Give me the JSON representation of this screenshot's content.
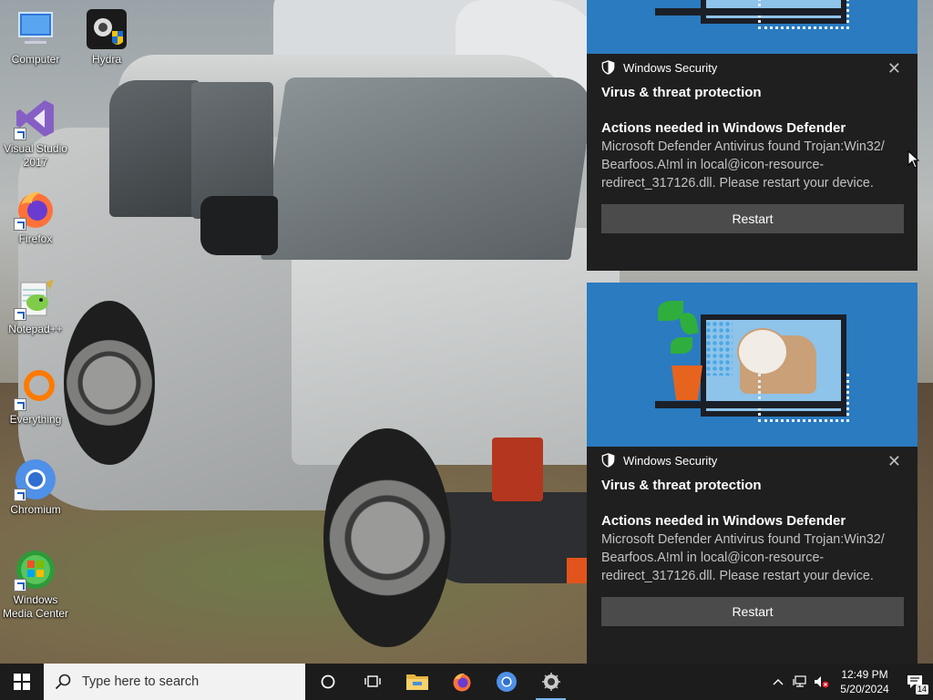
{
  "desktop": {
    "icons": [
      {
        "label": "Computer"
      },
      {
        "label": "Hydra"
      },
      {
        "label": "Visual Studio 2017"
      },
      {
        "label": "Firefox"
      },
      {
        "label": "Notepad++"
      },
      {
        "label": "Everything"
      },
      {
        "label": "Chromium"
      },
      {
        "label": "Windows Media Center"
      }
    ]
  },
  "notifications": [
    {
      "app_name": "Windows Security",
      "title": "Virus & threat protection",
      "subtitle": "Actions needed in Windows Defender",
      "body": "Microsoft Defender Antivirus found Trojan:Win32/ Bearfoos.A!ml in local@icon-resource-redirect_317126.dll. Please restart your device.",
      "button_label": "Restart",
      "close_symbol": "✕"
    },
    {
      "app_name": "Windows Security",
      "title": "Virus & threat protection",
      "subtitle": "Actions needed in Windows Defender",
      "body": "Microsoft Defender Antivirus found Trojan:Win32/ Bearfoos.A!ml in local@icon-resource-redirect_317126.dll. Please restart your device.",
      "button_label": "Restart",
      "close_symbol": "✕"
    }
  ],
  "taskbar": {
    "search_placeholder": "Type here to search",
    "pinned_icons": [
      "cortana-icon",
      "task-view-icon",
      "file-explorer-icon",
      "firefox-icon",
      "chromium-icon",
      "hydra-icon"
    ],
    "clock_time": "12:49 PM",
    "clock_date": "5/20/2024",
    "notification_count": "14"
  },
  "colors": {
    "toast_bg": "#1f1f1f",
    "toast_hero": "#2a7bc0",
    "button_bg": "#4b4b4b",
    "taskbar_bg": "#1c1c1c",
    "active_indicator": "#76b9ed"
  }
}
